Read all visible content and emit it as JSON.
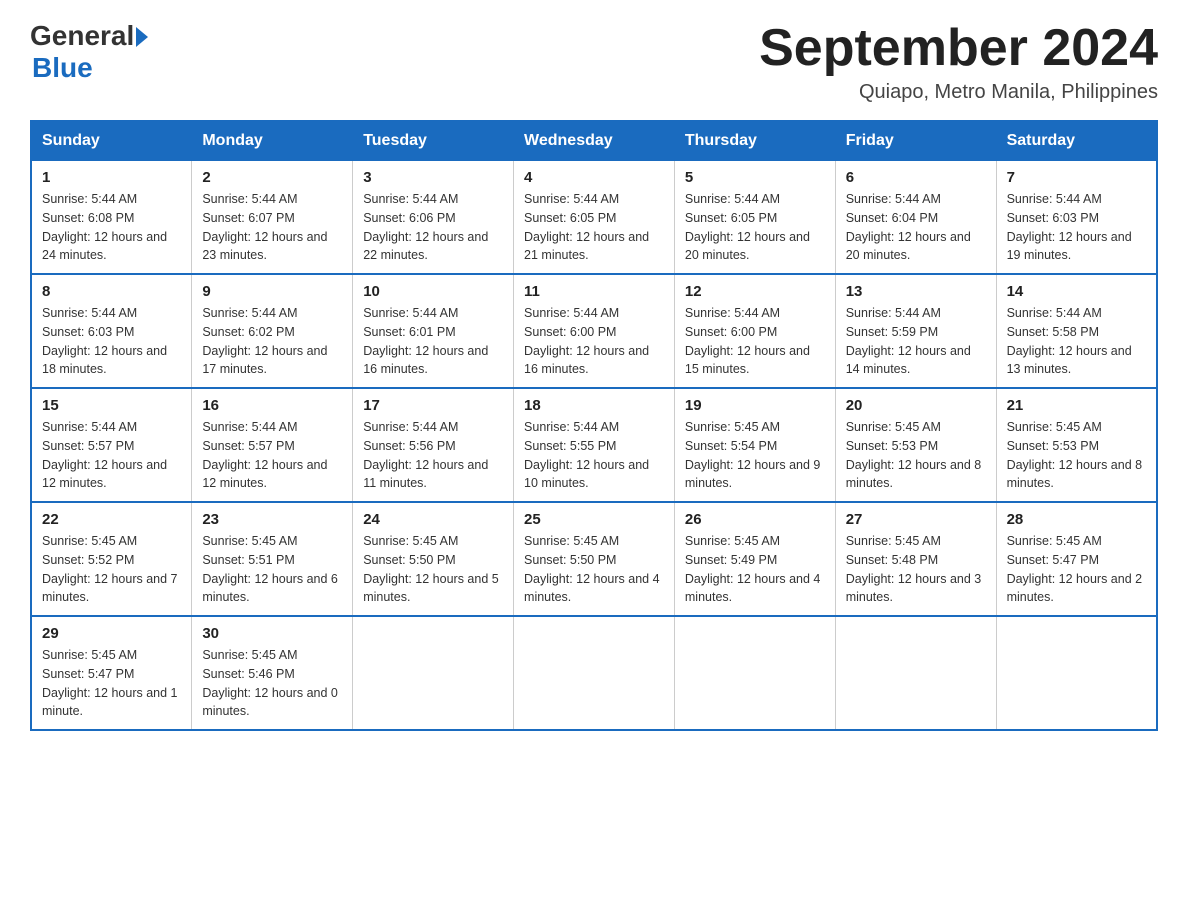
{
  "header": {
    "logo_general": "General",
    "logo_blue": "Blue",
    "month_year": "September 2024",
    "location": "Quiapo, Metro Manila, Philippines"
  },
  "weekdays": [
    "Sunday",
    "Monday",
    "Tuesday",
    "Wednesday",
    "Thursday",
    "Friday",
    "Saturday"
  ],
  "weeks": [
    [
      {
        "day": "1",
        "sunrise": "5:44 AM",
        "sunset": "6:08 PM",
        "daylight": "12 hours and 24 minutes."
      },
      {
        "day": "2",
        "sunrise": "5:44 AM",
        "sunset": "6:07 PM",
        "daylight": "12 hours and 23 minutes."
      },
      {
        "day": "3",
        "sunrise": "5:44 AM",
        "sunset": "6:06 PM",
        "daylight": "12 hours and 22 minutes."
      },
      {
        "day": "4",
        "sunrise": "5:44 AM",
        "sunset": "6:05 PM",
        "daylight": "12 hours and 21 minutes."
      },
      {
        "day": "5",
        "sunrise": "5:44 AM",
        "sunset": "6:05 PM",
        "daylight": "12 hours and 20 minutes."
      },
      {
        "day": "6",
        "sunrise": "5:44 AM",
        "sunset": "6:04 PM",
        "daylight": "12 hours and 20 minutes."
      },
      {
        "day": "7",
        "sunrise": "5:44 AM",
        "sunset": "6:03 PM",
        "daylight": "12 hours and 19 minutes."
      }
    ],
    [
      {
        "day": "8",
        "sunrise": "5:44 AM",
        "sunset": "6:03 PM",
        "daylight": "12 hours and 18 minutes."
      },
      {
        "day": "9",
        "sunrise": "5:44 AM",
        "sunset": "6:02 PM",
        "daylight": "12 hours and 17 minutes."
      },
      {
        "day": "10",
        "sunrise": "5:44 AM",
        "sunset": "6:01 PM",
        "daylight": "12 hours and 16 minutes."
      },
      {
        "day": "11",
        "sunrise": "5:44 AM",
        "sunset": "6:00 PM",
        "daylight": "12 hours and 16 minutes."
      },
      {
        "day": "12",
        "sunrise": "5:44 AM",
        "sunset": "6:00 PM",
        "daylight": "12 hours and 15 minutes."
      },
      {
        "day": "13",
        "sunrise": "5:44 AM",
        "sunset": "5:59 PM",
        "daylight": "12 hours and 14 minutes."
      },
      {
        "day": "14",
        "sunrise": "5:44 AM",
        "sunset": "5:58 PM",
        "daylight": "12 hours and 13 minutes."
      }
    ],
    [
      {
        "day": "15",
        "sunrise": "5:44 AM",
        "sunset": "5:57 PM",
        "daylight": "12 hours and 12 minutes."
      },
      {
        "day": "16",
        "sunrise": "5:44 AM",
        "sunset": "5:57 PM",
        "daylight": "12 hours and 12 minutes."
      },
      {
        "day": "17",
        "sunrise": "5:44 AM",
        "sunset": "5:56 PM",
        "daylight": "12 hours and 11 minutes."
      },
      {
        "day": "18",
        "sunrise": "5:44 AM",
        "sunset": "5:55 PM",
        "daylight": "12 hours and 10 minutes."
      },
      {
        "day": "19",
        "sunrise": "5:45 AM",
        "sunset": "5:54 PM",
        "daylight": "12 hours and 9 minutes."
      },
      {
        "day": "20",
        "sunrise": "5:45 AM",
        "sunset": "5:53 PM",
        "daylight": "12 hours and 8 minutes."
      },
      {
        "day": "21",
        "sunrise": "5:45 AM",
        "sunset": "5:53 PM",
        "daylight": "12 hours and 8 minutes."
      }
    ],
    [
      {
        "day": "22",
        "sunrise": "5:45 AM",
        "sunset": "5:52 PM",
        "daylight": "12 hours and 7 minutes."
      },
      {
        "day": "23",
        "sunrise": "5:45 AM",
        "sunset": "5:51 PM",
        "daylight": "12 hours and 6 minutes."
      },
      {
        "day": "24",
        "sunrise": "5:45 AM",
        "sunset": "5:50 PM",
        "daylight": "12 hours and 5 minutes."
      },
      {
        "day": "25",
        "sunrise": "5:45 AM",
        "sunset": "5:50 PM",
        "daylight": "12 hours and 4 minutes."
      },
      {
        "day": "26",
        "sunrise": "5:45 AM",
        "sunset": "5:49 PM",
        "daylight": "12 hours and 4 minutes."
      },
      {
        "day": "27",
        "sunrise": "5:45 AM",
        "sunset": "5:48 PM",
        "daylight": "12 hours and 3 minutes."
      },
      {
        "day": "28",
        "sunrise": "5:45 AM",
        "sunset": "5:47 PM",
        "daylight": "12 hours and 2 minutes."
      }
    ],
    [
      {
        "day": "29",
        "sunrise": "5:45 AM",
        "sunset": "5:47 PM",
        "daylight": "12 hours and 1 minute."
      },
      {
        "day": "30",
        "sunrise": "5:45 AM",
        "sunset": "5:46 PM",
        "daylight": "12 hours and 0 minutes."
      },
      null,
      null,
      null,
      null,
      null
    ]
  ]
}
